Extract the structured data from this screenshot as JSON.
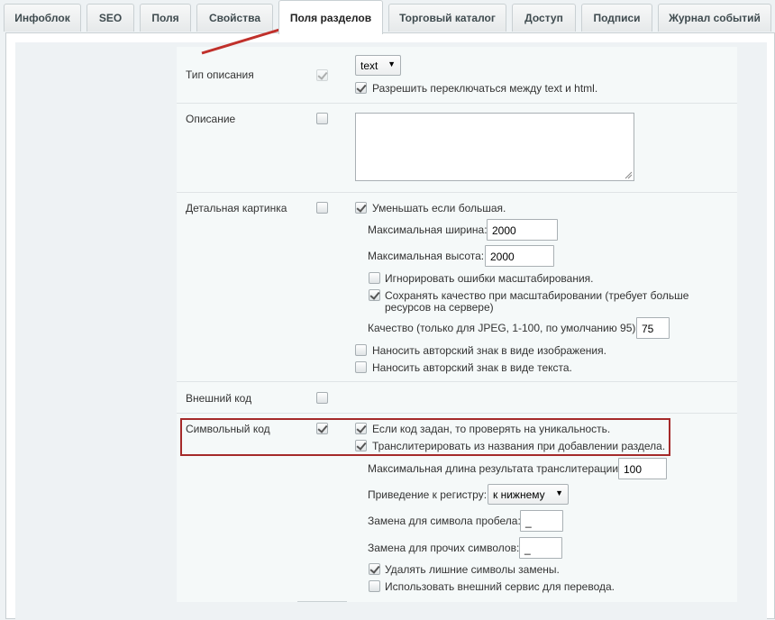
{
  "tabs": [
    {
      "label": "Инфоблок"
    },
    {
      "label": "SEO"
    },
    {
      "label": "Поля"
    },
    {
      "label": "Свойства"
    },
    {
      "label": "Поля разделов"
    },
    {
      "label": "Торговый каталог"
    },
    {
      "label": "Доступ"
    },
    {
      "label": "Подписи"
    },
    {
      "label": "Журнал событий"
    }
  ],
  "active_tab": "Поля разделов",
  "colors": {
    "annotation": "#c0302b",
    "highlight_box": "#a52a2a"
  },
  "fields": {
    "desc_type": {
      "label": "Тип описания",
      "select_value": "text",
      "allow_switch": "Разрешить переключаться между text и html."
    },
    "description": {
      "label": "Описание"
    },
    "detail_picture": {
      "label": "Детальная картинка",
      "shrink": "Уменьшать если большая.",
      "max_width_label": "Максимальная ширина:",
      "max_width": "2000",
      "max_height_label": "Максимальная высота:",
      "max_height": "2000",
      "ignore_errors": "Игнорировать ошибки масштабирования.",
      "keep_quality_1": "Сохранять качество при масштабировании (требует больше",
      "keep_quality_2": "ресурсов на сервере)",
      "quality_label": "Качество (только для JPEG, 1-100, по умолчанию 95):",
      "quality": "75",
      "watermark_image": "Наносить авторский знак в виде изображения.",
      "watermark_text": "Наносить авторский знак в виде текста."
    },
    "external_code": {
      "label": "Внешний код"
    },
    "symbolic_code": {
      "label": "Символьный код",
      "check_unique": "Если код задан, то проверять на уникальность.",
      "transliterate": "Транслитерировать из названия при добавлении раздела.",
      "max_len_label": "Максимальная длина результата транслитерации:",
      "max_len": "100",
      "case_label": "Приведение к регистру:",
      "case_value": "к нижнему",
      "space_label": "Замена для символа пробела:",
      "space_value": "_",
      "other_label": "Замена для прочих символов:",
      "other_value": "_",
      "remove_extra": "Удалять лишние символы замены.",
      "external_service": "Использовать внешний сервис для перевода."
    }
  }
}
